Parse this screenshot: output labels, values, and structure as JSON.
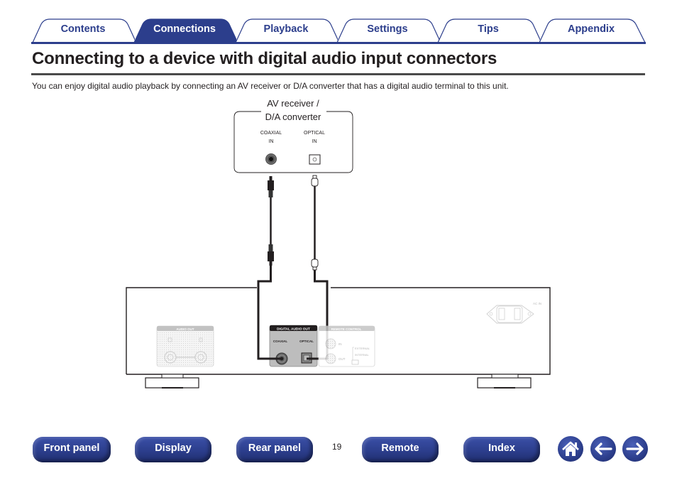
{
  "tabs": [
    {
      "label": "Contents",
      "active": false
    },
    {
      "label": "Connections",
      "active": true
    },
    {
      "label": "Playback",
      "active": false
    },
    {
      "label": "Settings",
      "active": false
    },
    {
      "label": "Tips",
      "active": false
    },
    {
      "label": "Appendix",
      "active": false
    }
  ],
  "page": {
    "title": "Connecting to a device with digital audio input connectors",
    "intro": "You can enjoy digital audio playback by connecting an AV receiver or D/A converter that has a digital audio terminal to this unit.",
    "number": "19"
  },
  "diagram": {
    "device_label_line1": "AV receiver /",
    "device_label_line2": "D/A converter",
    "coaxial_in_line1": "COAXIAL",
    "coaxial_in_line2": "IN",
    "optical_in_line1": "OPTICAL",
    "optical_in_line2": "IN",
    "digital_audio_out": "DIGITAL AUDIO OUT",
    "coaxial_out": "COAXIAL",
    "optical_out": "OPTICAL",
    "remote_control": "REMOTE CONTROL",
    "remote_in": "IN",
    "remote_out": "OUT",
    "remote_external": "EXTERNAL",
    "remote_internal": "INTERNAL",
    "audio_out": "AUDIO OUT",
    "audio_l": "L",
    "audio_r": "R",
    "ac_in": "AC IN"
  },
  "bottom_nav": {
    "buttons": [
      "Front panel",
      "Display",
      "Rear panel",
      "Remote",
      "Index"
    ],
    "icons": [
      "home-icon",
      "back-arrow-icon",
      "forward-arrow-icon"
    ]
  },
  "colors": {
    "brand_blue": "#2c3e8c",
    "text": "#231f20",
    "rule": "#4a4a4a"
  }
}
